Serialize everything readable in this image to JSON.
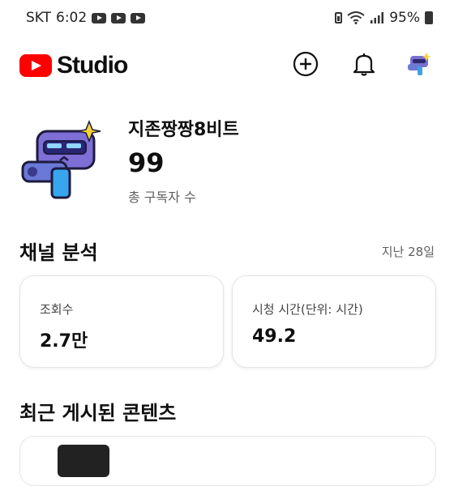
{
  "status_bar": {
    "carrier": "SKT",
    "time": "6:02",
    "battery": "95%"
  },
  "header": {
    "app_name": "Studio",
    "icons": [
      "create-icon",
      "notifications-icon",
      "account-avatar"
    ]
  },
  "channel": {
    "name": "지존짱짱8비트",
    "subscribers": "99",
    "subscribers_label": "총 구독자 수"
  },
  "analytics": {
    "title": "채널 분석",
    "period": "지난 28일",
    "cards": [
      {
        "label": "조회수",
        "value": "2.7만"
      },
      {
        "label": "시청 시간(단위: 시간)",
        "value": "49.2"
      }
    ]
  },
  "recent": {
    "title": "최근 게시된 콘텐츠"
  },
  "colors": {
    "brand": "#ff0000",
    "text": "#0f0f0f",
    "secondary": "#606060"
  }
}
